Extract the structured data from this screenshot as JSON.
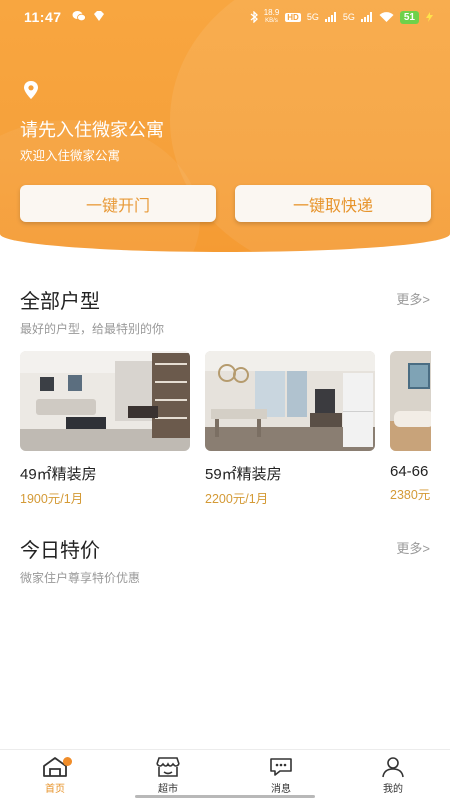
{
  "status_bar": {
    "time": "11:47",
    "speed": "18.9",
    "speed_unit": "KB/s",
    "hd": "HD",
    "network_1": "5G",
    "network_2": "5G",
    "battery": "51"
  },
  "header": {
    "title": "请先入住微家公寓",
    "subtitle": "欢迎入住微家公寓",
    "open_door_label": "一键开门",
    "pickup_parcel_label": "一键取快递"
  },
  "all_units": {
    "title": "全部户型",
    "more_label": "更多>",
    "subtitle": "最好的户型，给最特别的你",
    "items": [
      {
        "name": "49㎡精装房",
        "price": "1900元/1月"
      },
      {
        "name": "59㎡精装房",
        "price": "2200元/1月"
      },
      {
        "name": "64-66",
        "price": "2380元"
      }
    ]
  },
  "today_deals": {
    "title": "今日特价",
    "more_label": "更多>",
    "subtitle": "微家住户尊享特价优惠"
  },
  "tabbar": {
    "items": [
      {
        "label": "首页"
      },
      {
        "label": "超市"
      },
      {
        "label": "消息"
      },
      {
        "label": "我的"
      }
    ]
  },
  "colors": {
    "brand_orange": "#f6a13b",
    "price_gold": "#d49a36",
    "button_text": "#e7942c"
  }
}
